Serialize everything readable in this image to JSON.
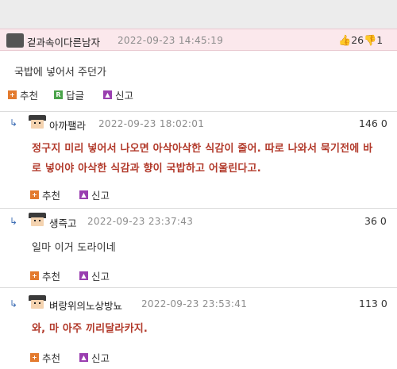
{
  "post": {
    "nickname": "겉과속이다른남자",
    "date": "2022-09-23 14:45:19",
    "upvotes": "26",
    "body": "국밥에 넣어서 주던가",
    "actions": {
      "recommend": "추천",
      "reply": "답글",
      "report": "신고"
    }
  },
  "comments": [
    {
      "nickname": "아까팰라",
      "date": "2022-09-23 18:02:01",
      "score": "146",
      "downs": "0",
      "lines": [
        "정구지 미리 넣어서 나오면 아삭아삭한 식감이 줄어. 따로 나와서 묵기전에 바",
        "로 넣어야 아삭한 식감과 향이 국밥하고 어울린다고."
      ],
      "recommend": "추천",
      "report": "신고"
    },
    {
      "nickname": "생즉고",
      "date": "2022-09-23 23:37:43",
      "score": "36",
      "downs": "0",
      "lines": [
        "일마 이거 도라이네"
      ],
      "recommend": "추천",
      "report": "신고"
    },
    {
      "nickname": "벼랑위의노상방뇨",
      "date": "2022-09-23 23:53:41",
      "score": "113",
      "downs": "0",
      "lines": [
        "와, 마 아주 끼리달라카지."
      ],
      "recommend": "추천",
      "report": "신고"
    }
  ],
  "icons": {
    "reply_arrow": "↳",
    "thumbs_up": "👍",
    "thumbs_down": "👎"
  },
  "colors": {
    "post_header_bg": "#fbe8ec",
    "reply_text": "#b23a2b",
    "recommend_icon": "#e37a2e",
    "reply_icon": "#4aa34a",
    "report_icon": "#9a3fb0"
  }
}
